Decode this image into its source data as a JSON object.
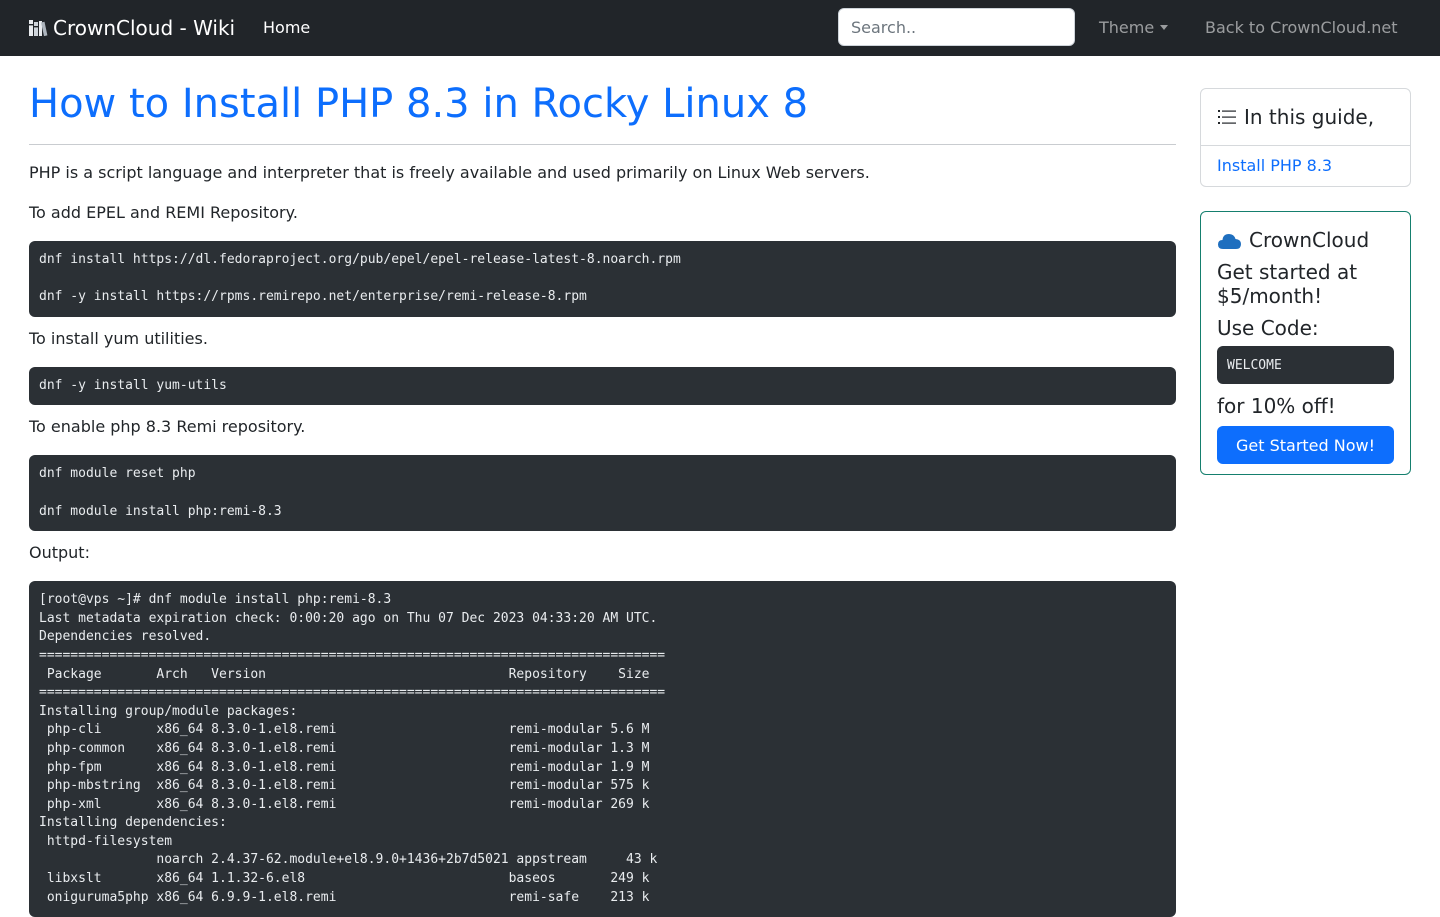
{
  "navbar": {
    "brand": "CrownCloud - Wiki",
    "brand_icon": "books-icon",
    "home": "Home",
    "search_placeholder": "Search..",
    "theme": "Theme",
    "back": "Back to CrownCloud.net"
  },
  "article": {
    "title": "How to Install PHP 8.3 in Rocky Linux 8",
    "intro": "PHP is a script language and interpreter that is freely available and used primarily on Linux Web servers.",
    "step1_text": "To add EPEL and REMI Repository.",
    "step1_code": "dnf install https://dl.fedoraproject.org/pub/epel/epel-release-latest-8.noarch.rpm\n\ndnf -y install https://rpms.remirepo.net/enterprise/remi-release-8.rpm",
    "step2_text": "To install yum utilities.",
    "step2_code": "dnf -y install yum-utils",
    "step3_text": "To enable php 8.3 Remi repository.",
    "step3_code": "dnf module reset php\n\ndnf module install php:remi-8.3",
    "output_label": "Output:",
    "output_code": "[root@vps ~]# dnf module install php:remi-8.3\nLast metadata expiration check: 0:00:20 ago on Thu 07 Dec 2023 04:33:20 AM UTC.\nDependencies resolved.\n================================================================================\n Package       Arch   Version                               Repository    Size\n================================================================================\nInstalling group/module packages:\n php-cli       x86_64 8.3.0-1.el8.remi                      remi-modular 5.6 M\n php-common    x86_64 8.3.0-1.el8.remi                      remi-modular 1.3 M\n php-fpm       x86_64 8.3.0-1.el8.remi                      remi-modular 1.9 M\n php-mbstring  x86_64 8.3.0-1.el8.remi                      remi-modular 575 k\n php-xml       x86_64 8.3.0-1.el8.remi                      remi-modular 269 k\nInstalling dependencies:\n httpd-filesystem\n               noarch 2.4.37-62.module+el8.9.0+1436+2b7d5021 appstream     43 k\n libxslt       x86_64 1.1.32-6.el8                          baseos       249 k\n oniguruma5php x86_64 6.9.9-1.el8.remi                      remi-safe    213 k"
  },
  "toc": {
    "header": "In this guide,",
    "icon": "list-icon",
    "items": [
      "Install PHP 8.3"
    ]
  },
  "promo": {
    "title": "CrownCloud",
    "icon": "cloud-icon",
    "headline": "Get started at $5/month!",
    "code_label": "Use Code:",
    "code": "WELCOME",
    "discount": "for 10% off!",
    "button": "Get Started Now!"
  },
  "colors": {
    "navbar_bg": "#212529",
    "link": "#0d6efd",
    "code_bg": "#2b3035",
    "promo_border": "#157f6e"
  }
}
